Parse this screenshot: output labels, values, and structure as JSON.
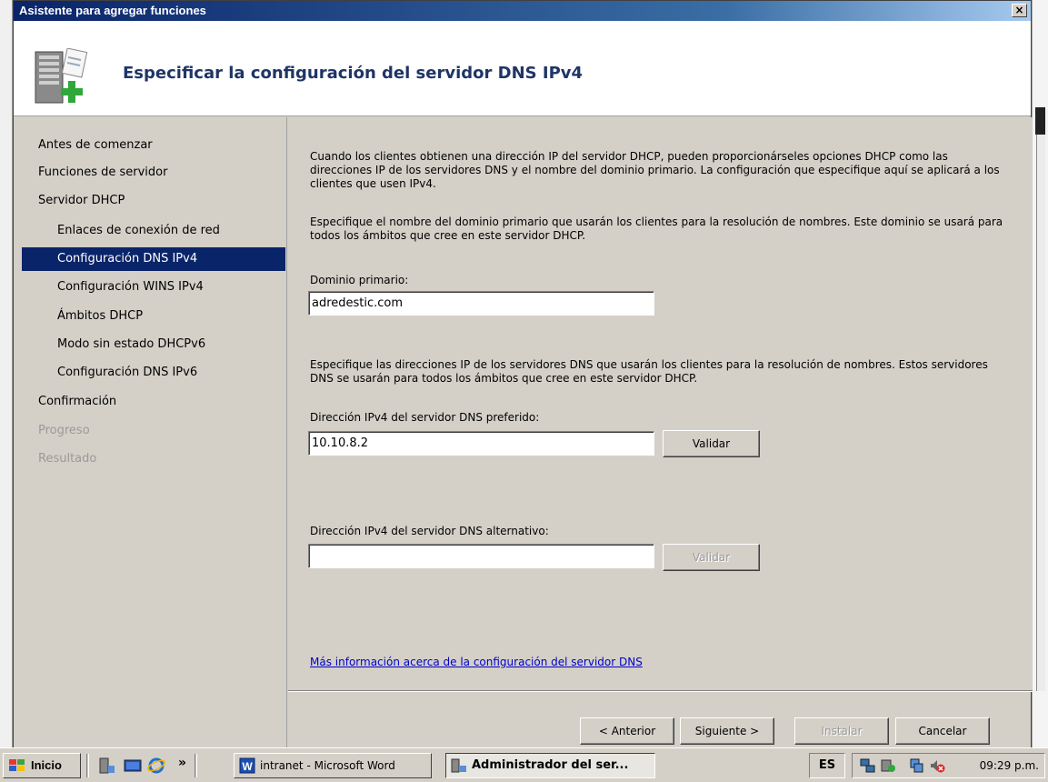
{
  "window": {
    "title": "Asistente para agregar funciones",
    "close_label": "×"
  },
  "header": {
    "title": "Especificar la configuración del servidor DNS IPv4",
    "icon": "server-add-icon"
  },
  "nav": {
    "items": [
      {
        "label": "Antes de comenzar",
        "level": 0,
        "state": "normal"
      },
      {
        "label": "Funciones de servidor",
        "level": 0,
        "state": "normal"
      },
      {
        "label": "Servidor DHCP",
        "level": 0,
        "state": "normal"
      },
      {
        "label": "Enlaces de conexión de red",
        "level": 1,
        "state": "normal"
      },
      {
        "label": "Configuración DNS IPv4",
        "level": 1,
        "state": "selected"
      },
      {
        "label": "Configuración WINS IPv4",
        "level": 1,
        "state": "normal"
      },
      {
        "label": "Ámbitos DHCP",
        "level": 1,
        "state": "normal"
      },
      {
        "label": "Modo sin estado DHCPv6",
        "level": 1,
        "state": "normal"
      },
      {
        "label": "Configuración DNS IPv6",
        "level": 1,
        "state": "normal"
      },
      {
        "label": "Confirmación",
        "level": 0,
        "state": "normal"
      },
      {
        "label": "Progreso",
        "level": 0,
        "state": "disabled"
      },
      {
        "label": "Resultado",
        "level": 0,
        "state": "disabled"
      }
    ]
  },
  "content": {
    "intro": "Cuando los clientes obtienen una dirección IP del servidor DHCP, pueden proporcionárseles opciones DHCP como las direcciones IP de los servidores DNS y el nombre del dominio primario. La configuración que especifique aquí se aplicará a los clientes que usen IPv4.",
    "domain_instructions": "Especifique el nombre del dominio primario que usarán los clientes para la resolución de nombres. Este dominio se usará para todos los ámbitos que cree en este servidor DHCP.",
    "domain_label": "Dominio primario:",
    "domain_value": "adredestic.com",
    "dns_instructions": "Especifique las direcciones IP de los servidores DNS que usarán los clientes para la resolución de nombres. Estos servidores DNS se usarán para todos los ámbitos que cree en este servidor DHCP.",
    "preferred_label": "Dirección IPv4 del servidor DNS preferido:",
    "preferred_value": "10.10.8.2",
    "validate_label": "Validar",
    "alternate_label": "Dirección IPv4 del servidor DNS alternativo:",
    "alternate_value": "",
    "validate2_label": "Validar",
    "more_info_link": "Más información acerca de la configuración del servidor DNS"
  },
  "footer": {
    "back_label": "< Anterior",
    "next_label": "Siguiente >",
    "install_label": "Instalar",
    "cancel_label": "Cancelar"
  },
  "taskbar": {
    "start_label": "Inicio",
    "chevron": "»",
    "tasks": [
      {
        "label": "intranet - Microsoft Word",
        "icon": "word-icon",
        "active": false
      },
      {
        "label": "Administrador del ser...",
        "icon": "server-manager-icon",
        "active": true
      }
    ],
    "language": "ES",
    "clock": "09:29 p.m."
  },
  "colors": {
    "titlebar": "#0a246a",
    "selection": "#0a246a",
    "header_title": "#1f3566",
    "link": "#0000cc"
  }
}
